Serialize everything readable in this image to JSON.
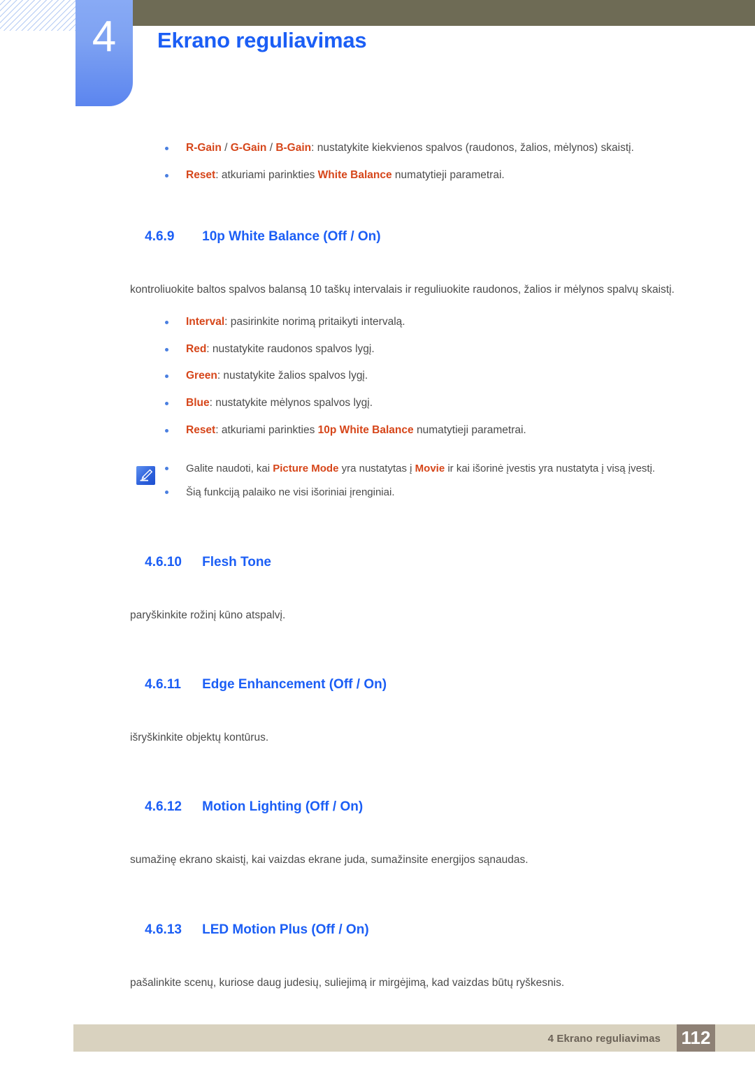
{
  "header": {
    "chapter_number": "4",
    "chapter_title": "Ekrano reguliavimas"
  },
  "top_bullets": [
    {
      "segments": [
        {
          "text": "R-Gain",
          "style": "keyword"
        },
        {
          "text": " / ",
          "style": "plain"
        },
        {
          "text": "G-Gain",
          "style": "keyword"
        },
        {
          "text": " / ",
          "style": "plain"
        },
        {
          "text": "B-Gain",
          "style": "keyword"
        },
        {
          "text": ": nustatykite kiekvienos spalvos (raudonos, žalios, mėlynos) skaistį.",
          "style": "plain"
        }
      ]
    },
    {
      "segments": [
        {
          "text": "Reset",
          "style": "keyword"
        },
        {
          "text": ": atkuriami parinkties ",
          "style": "plain"
        },
        {
          "text": "White Balance",
          "style": "keyword"
        },
        {
          "text": " numatytieji parametrai.",
          "style": "plain"
        }
      ]
    }
  ],
  "sections": [
    {
      "number": "4.6.9",
      "title": "10p White Balance (Off / On)",
      "body": "kontroliuokite baltos spalvos balansą 10 taškų intervalais ir reguliuokite raudonos, žalios ir mėlynos spalvų skaistį."
    },
    {
      "number": "4.6.10",
      "title": "Flesh Tone",
      "body": "paryškinkite rožinį kūno atspalvį."
    },
    {
      "number": "4.6.11",
      "title": "Edge Enhancement (Off / On)",
      "body": "išryškinkite objektų kontūrus."
    },
    {
      "number": "4.6.12",
      "title": "Motion Lighting (Off / On)",
      "body": "sumažinę ekrano skaistį, kai vaizdas ekrane juda, sumažinsite energijos sąnaudas."
    },
    {
      "number": "4.6.13",
      "title": "LED Motion Plus (Off / On)",
      "body": "pašalinkite scenų, kuriose daug judesių, suliejimą ir mirgėjimą, kad vaizdas būtų ryškesnis."
    }
  ],
  "option_bullets": [
    {
      "segments": [
        {
          "text": "Interval",
          "style": "keyword"
        },
        {
          "text": ": pasirinkite norimą pritaikyti intervalą.",
          "style": "plain"
        }
      ]
    },
    {
      "segments": [
        {
          "text": "Red",
          "style": "keyword"
        },
        {
          "text": ": nustatykite raudonos spalvos lygį.",
          "style": "plain"
        }
      ]
    },
    {
      "segments": [
        {
          "text": "Green",
          "style": "keyword"
        },
        {
          "text": ": nustatykite žalios spalvos lygį.",
          "style": "plain"
        }
      ]
    },
    {
      "segments": [
        {
          "text": "Blue",
          "style": "keyword"
        },
        {
          "text": ": nustatykite mėlynos spalvos lygį.",
          "style": "plain"
        }
      ]
    },
    {
      "segments": [
        {
          "text": "Reset",
          "style": "keyword"
        },
        {
          "text": ": atkuriami parinkties ",
          "style": "plain"
        },
        {
          "text": "10p White Balance",
          "style": "keyword"
        },
        {
          "text": " numatytieji parametrai.",
          "style": "plain"
        }
      ]
    }
  ],
  "note": {
    "icon": "note-pen-icon",
    "items": [
      {
        "segments": [
          {
            "text": "Galite naudoti, kai ",
            "style": "plain"
          },
          {
            "text": "Picture Mode",
            "style": "keyword"
          },
          {
            "text": " yra nustatytas į ",
            "style": "plain"
          },
          {
            "text": "Movie",
            "style": "keyword"
          },
          {
            "text": " ir kai išorinė įvestis yra nustatyta į visą įvestį.",
            "style": "plain"
          }
        ]
      },
      {
        "segments": [
          {
            "text": "Šią funkciją palaiko ne visi išoriniai įrenginiai.",
            "style": "plain"
          }
        ]
      }
    ]
  },
  "footer": {
    "text": "4 Ekrano reguliavimas",
    "page_number": "112"
  },
  "colors": {
    "heading_blue": "#1b5ef5",
    "keyword_orange": "#d6461a",
    "body_gray": "#4b4b4b",
    "olive_bar": "#6e6b55",
    "tab_blue": "#5b85ef",
    "footer_band": "#d9d2bf",
    "footer_page_box": "#8e8175"
  }
}
